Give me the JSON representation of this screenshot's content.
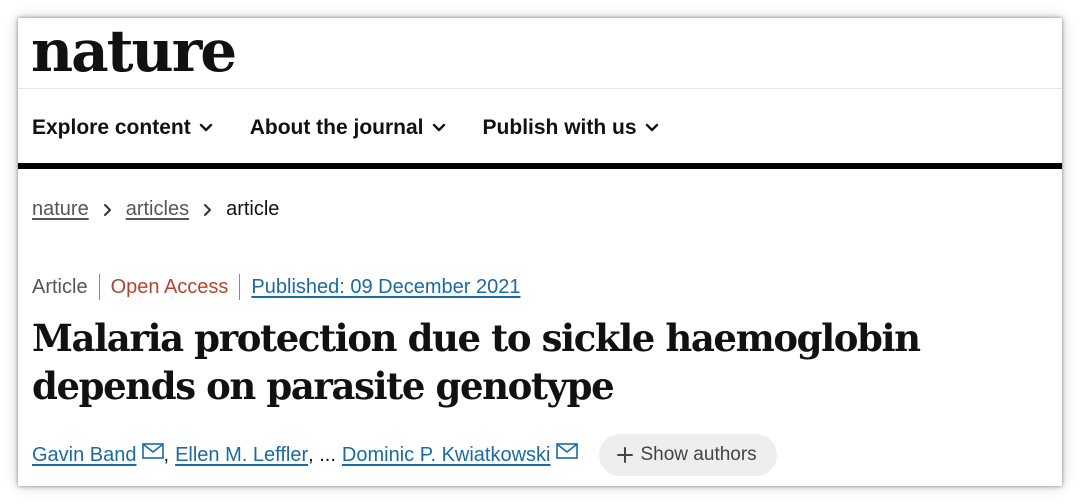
{
  "header": {
    "logo": "nature"
  },
  "nav": {
    "items": [
      {
        "label": "Explore content"
      },
      {
        "label": "About the journal"
      },
      {
        "label": "Publish with us"
      }
    ]
  },
  "breadcrumb": [
    {
      "label": "nature"
    },
    {
      "label": "articles"
    },
    {
      "label": "article"
    }
  ],
  "article": {
    "type": "Article",
    "access": "Open Access",
    "published": "Published: 09 December 2021",
    "title": "Malaria protection due to sickle haemoglobin depends on parasite genotype",
    "authors": {
      "first": "Gavin Band",
      "second": "Ellen M. Leffler",
      "separator_comma": ",",
      "ellipsis": ", ...",
      "last": "Dominic P. Kwiatkowski"
    },
    "show_authors_label": "Show authors"
  },
  "colors": {
    "link": "#1b6aa2",
    "open_access": "#b2452f",
    "muted_text": "#555555",
    "pill_background": "#eceef0"
  },
  "icons": {
    "nav_chevron": "chevron-down-icon",
    "breadcrumb_separator": "chevron-right-icon",
    "author_contact": "mail-icon",
    "show_authors": "plus-icon"
  }
}
